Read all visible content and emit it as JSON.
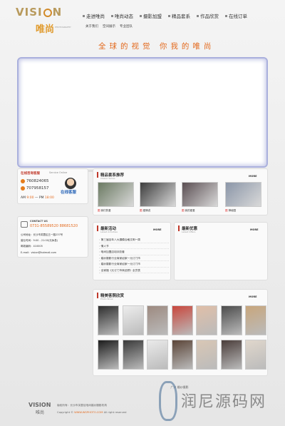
{
  "logo": {
    "word": "VISI",
    "word_end": "N",
    "cn": "唯尚",
    "sub": "PHOTOGRAPHY"
  },
  "nav": [
    "走进唯尚",
    "唯尚动态",
    "摄影加盟",
    "精品套系",
    "作品欣赏",
    "在线订单"
  ],
  "subnav": [
    "关于我们",
    "空间展示",
    "专业团队"
  ],
  "slogan": "全球的视觉  你我的唯尚",
  "service": {
    "title": "在线咨询客服",
    "title_en": "Service Online",
    "qq1": "760824065",
    "qq2": "707958157",
    "hours_label": "AM",
    "hours_start": "9:00",
    "hours_mid": "— PM",
    "hours_end": "18:00",
    "online_label": "在线客服"
  },
  "contact": {
    "title": "CONTACT US",
    "phones": "0731-85589520  88681520",
    "lines": [
      "公司地址：长沙市芙蓉区五一路237号",
      "营业时间：9:00 - 21:00(无休息)",
      "邮政编码：410005",
      "E-mail：vision@hotmail.com"
    ]
  },
  "works": {
    "title": "精品套系推荐",
    "subtitle": "Classic Series",
    "more": "MORE",
    "captions": [
      {
        "tag": "图",
        "text": "我们的爱"
      },
      {
        "tag": "图",
        "text": "爱情说"
      },
      {
        "tag": "图",
        "text": "我的爱爱"
      },
      {
        "tag": "图",
        "text": "神秘园"
      }
    ],
    "photo_colors": [
      "#6b7a62",
      "#3d3d3d",
      "#5a4e52",
      "#8b96a8"
    ]
  },
  "activities": {
    "title": "最新活动",
    "subtitle": "Latest Activities",
    "more": "MORE",
    "items": [
      "第三届百年八大摄模合格文明一周",
      "情人节",
      "唯尚加盟店培训总套",
      "婚纱摄影行业商家如家一元订门市",
      "婚纱摄影行业商家如家一元订门市",
      "全家福《元订门市商品预》全员表"
    ]
  },
  "offers": {
    "title": "最新优惠",
    "subtitle": "Latest Offers",
    "more": "MORE"
  },
  "gallery": {
    "title": "精美客照欣赏",
    "subtitle": "Photo Show",
    "more": "MORE",
    "row1": [
      "#2e2e2e",
      "#ededed",
      "#9d8a80",
      "#c9473d",
      "#e0bfa8",
      "#4c4c4c",
      "#c8a67c"
    ],
    "row2": [
      "#1c1c1c",
      "#3a3a3a",
      "#eaeaea",
      "#5b4538",
      "#d9c7b5",
      "#4a3d3a",
      "#e0d7cc"
    ]
  },
  "footer": {
    "bar": "广州 婚纱摄影",
    "logo": "VISION",
    "logo_cn": "唯尚",
    "addr": "版权所有：长沙市芙蓉区唯尚婚纱摄影机构",
    "copy_pre": "Copyright ©",
    "copy_url": "WWW.WSPHOTO.COM",
    "copy_post": "All right reserved",
    "watermark": "润尼源码网"
  }
}
